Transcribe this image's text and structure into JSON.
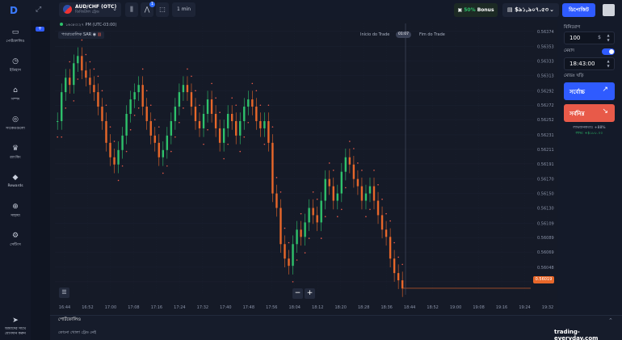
{
  "topbar": {
    "asset_name": "AUD/CHF (OTC)",
    "asset_sub": "ডিজিটাল ট্রেড",
    "timeframe": "1 min",
    "tools_badge": "1",
    "bonus_pct": "50%",
    "bonus_label": "Bonus",
    "balance": "$৯১,৯০৭.৫৩",
    "deposit_label": "ডিপোজিট"
  },
  "sidebar": {
    "items": [
      {
        "icon": "portfolio-icon",
        "label": "পোর্টফোলিও"
      },
      {
        "icon": "history-icon",
        "label": "ইতিহাস"
      },
      {
        "icon": "market-icon",
        "label": "সম্পদ"
      },
      {
        "icon": "signals-icon",
        "label": "সংকেতগুলো"
      },
      {
        "icon": "trophy-icon",
        "label": "র‍্যাংকিং"
      },
      {
        "icon": "rewards-icon",
        "label": "Rewards"
      },
      {
        "icon": "help-icon",
        "label": "সাহায্য"
      },
      {
        "icon": "settings-icon",
        "label": "সেটিংস"
      }
    ],
    "invite": "আমাদের সাথে যোগদান করুন"
  },
  "chart": {
    "status": "১৬:৪৩:২৭ PM (UTC-03:00)",
    "indicator": "প্যারাবোলিক SAR",
    "trade_start": "Início do Trade",
    "timer": "01:07",
    "trade_end": "Fim do Trade",
    "current_price": "0.56019",
    "colors": {
      "up": "#2ec16b",
      "down": "#e8672a",
      "sar": "#e85a49",
      "bg": "#151a27"
    }
  },
  "chart_data": {
    "type": "line",
    "title": "",
    "y_ticks": [
      "0.56374",
      "0.56353",
      "0.56333",
      "0.56313",
      "0.56292",
      "0.56272",
      "0.56252",
      "0.56231",
      "0.56211",
      "0.56191",
      "0.56170",
      "0.56150",
      "0.56130",
      "0.56109",
      "0.56089",
      "0.56069",
      "0.56048",
      "0.56028"
    ],
    "x_ticks": [
      "16:44",
      "16:52",
      "17:00",
      "17:08",
      "17:16",
      "17:24",
      "17:32",
      "17:40",
      "17:48",
      "17:56",
      "18:04",
      "18:12",
      "18:20",
      "18:28",
      "18:36",
      "18:44",
      "18:52",
      "19:00",
      "19:08",
      "19:16",
      "19:24",
      "19:32"
    ],
    "ylim": [
      0.5601,
      0.56385
    ],
    "series": [
      {
        "values": [
          0.5625,
          0.5629,
          0.5631,
          0.563,
          0.5633,
          0.5634,
          0.5632,
          0.5631,
          0.563,
          0.5629,
          0.5627,
          0.5625,
          0.5622,
          0.562,
          0.5619,
          0.5621,
          0.5623,
          0.5626,
          0.5628,
          0.5629,
          0.563,
          0.5627,
          0.5625,
          0.5623,
          0.5622,
          0.562,
          0.5621,
          0.5623,
          0.5625,
          0.5627,
          0.5629,
          0.563,
          0.5629,
          0.5627,
          0.5625,
          0.5624,
          0.5626,
          0.5628,
          0.5626,
          0.5624,
          0.5622,
          0.5624,
          0.5626,
          0.5625,
          0.5623,
          0.5625,
          0.5627,
          0.5628,
          0.5627,
          0.5625,
          0.5624,
          0.5625,
          0.5622,
          0.5615,
          0.5613,
          0.5608,
          0.5606,
          0.5605,
          0.5608,
          0.561,
          0.5609,
          0.5611,
          0.5613,
          0.5612,
          0.5611,
          0.5614,
          0.5617,
          0.5616,
          0.5614,
          0.5615,
          0.5618,
          0.562,
          0.5619,
          0.5617,
          0.5616,
          0.5614,
          0.5615,
          0.5616,
          0.5614,
          0.5612,
          0.561,
          0.5609,
          0.5606,
          0.5604,
          0.5603,
          0.56019
        ]
      }
    ]
  },
  "panel": {
    "amount_label": "বিনিয়োগ",
    "amount": "100",
    "amount_unit": "$",
    "time_label": "মেয়াদ",
    "time": "18:43:00",
    "mode_label": "মোডঃ ঘড়ি",
    "up_label": "সর্বোচ্চ",
    "down_label": "সর্বনিম্ন",
    "payout_label": "লাভজনকতাঃ +88%",
    "payout_value": "লাভ: +$১৮৮.০০"
  },
  "bottom": {
    "title": "পোর্টফোলিও",
    "empty": "কোনো খোলা ট্রেড নেই",
    "watermark": "trading-everyday.com"
  }
}
